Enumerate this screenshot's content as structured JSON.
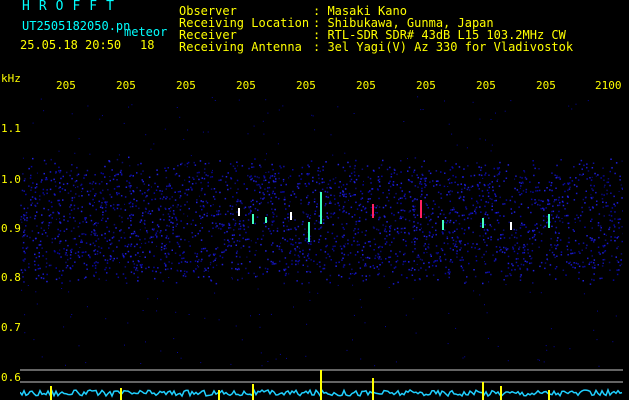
{
  "app": {
    "logo": "HROFFT",
    "filename": "UT2505182050.pn",
    "timestamp": "25.05.18 20:50",
    "meteor_label": "meteor",
    "meteor_count": "18"
  },
  "info": {
    "labels": [
      "Observer",
      "Receiving Location",
      "Receiver",
      "Receiving Antenna"
    ],
    "values": [
      ": Masaki Kano",
      ": Shibukawa, Gunma, Japan",
      ": RTL-SDR SDR# 43dB L15 103.2MHz CW",
      ": 3el Yagi(V) Az 330 for Vladivostok"
    ]
  },
  "axes": {
    "y_unit": "kHz",
    "y_ticks": [
      "1.1",
      "1.0",
      "0.9",
      "0.8",
      "0.7",
      "0.6"
    ],
    "x_ticks": [
      "205",
      "205",
      "205",
      "205",
      "205",
      "205",
      "205",
      "205",
      "205",
      "2100"
    ]
  },
  "colors": {
    "label": "#ffff00",
    "axis": "#00ffff",
    "noise": "#1010a0",
    "echo_hot": "#ff2060",
    "echo_warm": "#40ffc0",
    "power_trace": "#20d0ff",
    "power_spike": "#ffff00",
    "guide_line": "#c8c8c8"
  }
}
